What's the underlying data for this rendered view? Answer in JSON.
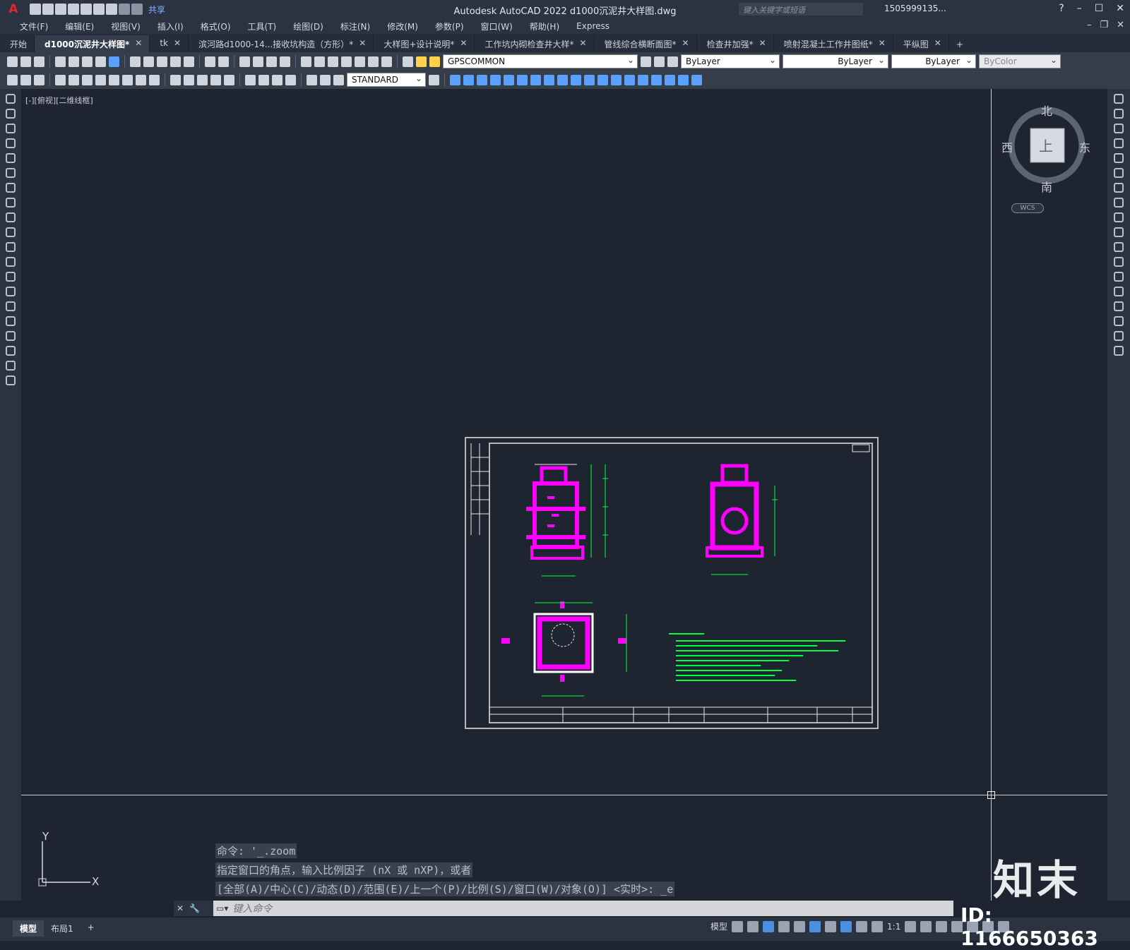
{
  "app": {
    "title": "Autodesk AutoCAD 2022    d1000沉泥井大样图.dwg",
    "logo": "A",
    "share_label": "共享",
    "search_placeholder": "键入关键字或短语",
    "user": "1505999135...",
    "help": "?"
  },
  "menu": [
    "文件(F)",
    "编辑(E)",
    "视图(V)",
    "插入(I)",
    "格式(O)",
    "工具(T)",
    "绘图(D)",
    "标注(N)",
    "修改(M)",
    "参数(P)",
    "窗口(W)",
    "帮助(H)",
    "Express"
  ],
  "tabs": [
    {
      "label": "开始",
      "active": false,
      "closable": false
    },
    {
      "label": "d1000沉泥井大样图*",
      "active": true,
      "closable": true
    },
    {
      "label": "tk",
      "active": false,
      "closable": true
    },
    {
      "label": "滨河路d1000-14...接收坑构造（方形）*",
      "active": false,
      "closable": true
    },
    {
      "label": "大样图+设计说明*",
      "active": false,
      "closable": true
    },
    {
      "label": "工作坑内砌检查井大样*",
      "active": false,
      "closable": true
    },
    {
      "label": "管线综合横断面图*",
      "active": false,
      "closable": true
    },
    {
      "label": "检查井加强*",
      "active": false,
      "closable": true
    },
    {
      "label": "喷射混凝土工作井图纸*",
      "active": false,
      "closable": true
    },
    {
      "label": "平纵图",
      "active": false,
      "closable": true
    }
  ],
  "toolbar": {
    "layer": "GPSCOMMON",
    "color": "ByLayer",
    "linetype": "ByLayer",
    "lineweight": "ByLayer",
    "plotstyle": "ByColor",
    "textstyle": "STANDARD"
  },
  "viewport": {
    "label": "[-][俯视][二维线框]",
    "viewcube": {
      "north": "北",
      "south": "南",
      "east": "东",
      "west": "西",
      "top": "上"
    },
    "wcs": "WCS"
  },
  "ucs": {
    "x": "X",
    "y": "Y"
  },
  "command_history": [
    "命令: '_.zoom",
    "指定窗口的角点，输入比例因子 (nX 或 nXP)，或者",
    "[全部(A)/中心(C)/动态(D)/范围(E)/上一个(P)/比例(S)/窗口(W)/对象(O)] <实时>: _e"
  ],
  "command_placeholder": "键入命令",
  "layout_tabs": [
    "模型",
    "布局1"
  ],
  "status": {
    "model": "模型",
    "scale": "1:1"
  },
  "watermark": {
    "brand": "知末",
    "id": "ID: 1166650363"
  },
  "colors": {
    "accent": "#4b8fe0",
    "magenta": "#ff00ff",
    "green": "#00ff3c",
    "canvas": "#1f2431"
  }
}
